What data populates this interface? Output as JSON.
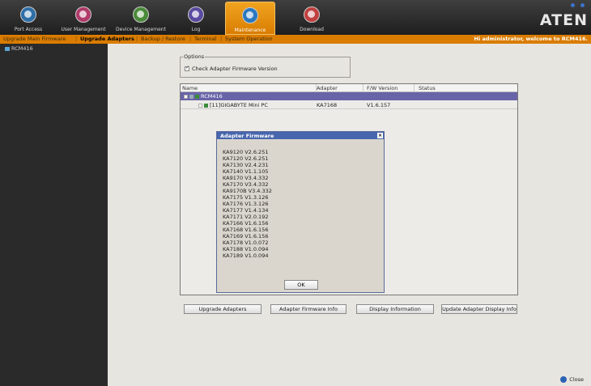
{
  "nav": {
    "items": [
      {
        "label": "Port Access",
        "icon": "port-access-icon",
        "color": "#2f6fa8"
      },
      {
        "label": "User Management",
        "icon": "user-management-icon",
        "color": "#b03a6a"
      },
      {
        "label": "Device Management",
        "icon": "device-management-icon",
        "color": "#4a8a3a"
      },
      {
        "label": "Log",
        "icon": "log-icon",
        "color": "#5a4aa0"
      },
      {
        "label": "Maintenance",
        "icon": "maintenance-icon",
        "color": "#2a78c0"
      },
      {
        "label": "Download",
        "icon": "download-icon",
        "color": "#c04040"
      }
    ],
    "active": "Maintenance",
    "logo": "ATEN"
  },
  "submenu": {
    "items": [
      "Upgrade Main Firmware",
      "Upgrade Adapters",
      "Backup / Restore",
      "Terminal",
      "System Operation"
    ],
    "active": "Upgrade Adapters",
    "welcome": "Hi administrator, welcome to RCM416."
  },
  "sidebar": {
    "root": "RCM416"
  },
  "options": {
    "legend": "Options",
    "check_firmware_label": "Check Adapter Firmware Version",
    "check_firmware_checked": true
  },
  "table": {
    "columns": [
      "Name",
      "Adapter",
      "F/W Version",
      "Status"
    ],
    "root_row": {
      "name": "RCM416"
    },
    "rows": [
      {
        "name": "[11]GIGABYTE Mini PC",
        "adapter": "KA7168",
        "fw_version": "V1.6.157",
        "status": ""
      }
    ]
  },
  "buttons": {
    "upgrade": "Upgrade Adapters",
    "firmware_info": "Adapter Firmware Info",
    "display_info": "Display Information",
    "update_display": "Update Adapter Display Info"
  },
  "close_label": "Close",
  "dialog": {
    "title": "Adapter Firmware",
    "close_glyph": "×",
    "firmware": [
      "KA9120 V2.6.251",
      "KA7120 V2.6.251",
      "KA7130 V2.4.231",
      "KA7140 V1.1.105",
      "KA9170 V3.4.332",
      "KA7170 V3.4.332",
      "KA9170B V3.4.332",
      "KA7175 V1.3.126",
      "KA7176 V1.3.126",
      "KA7177 V1.4.134",
      "KA7171 V2.0.192",
      "KA7166 V1.6.156",
      "KA7168 V1.6.156",
      "KA7169 V1.6.156",
      "KA7178 V1.0.072",
      "KA7188 V1.0.094",
      "KA7189 V1.0.094"
    ],
    "ok": "OK"
  }
}
